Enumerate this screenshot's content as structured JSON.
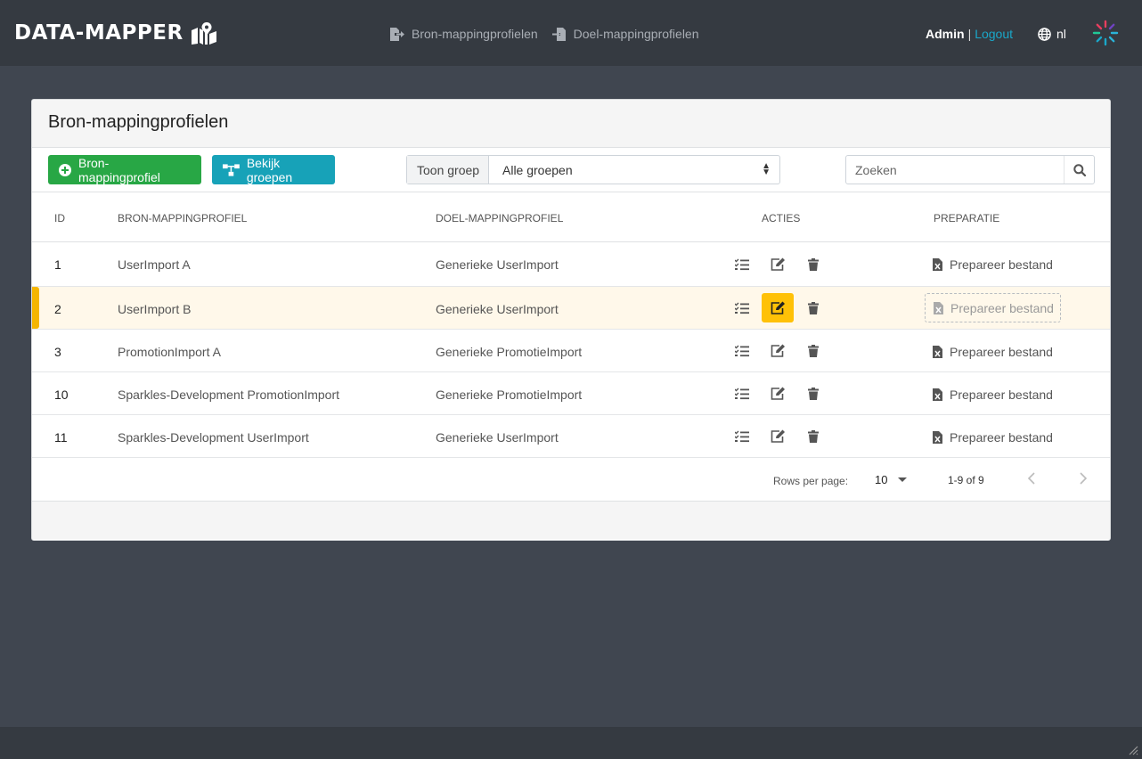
{
  "brand": {
    "name": "DATA-MAPPER"
  },
  "nav": {
    "source_profiles": "Bron-mappingprofielen",
    "target_profiles": "Doel-mappingprofielen",
    "user": "Admin",
    "separator": "|",
    "logout": "Logout",
    "language": "nl"
  },
  "card": {
    "title": "Bron-mappingprofielen",
    "add_button": "Bron-mappingprofiel",
    "groups_button": "Bekijk groepen",
    "group_filter_label": "Toon groep",
    "group_filter_value": "Alle groepen",
    "search_placeholder": "Zoeken"
  },
  "table": {
    "columns": {
      "id": "ID",
      "source": "BRON-MAPPINGPROFIEL",
      "target": "DOEL-MAPPINGPROFIEL",
      "actions": "ACTIES",
      "prep": "PREPARATIE"
    },
    "prep_label": "Prepareer bestand",
    "rows": [
      {
        "id": "1",
        "source": "UserImport A",
        "target": "Generieke UserImport"
      },
      {
        "id": "2",
        "source": "UserImport B",
        "target": "Generieke UserImport"
      },
      {
        "id": "3",
        "source": "PromotionImport A",
        "target": "Generieke PromotieImport"
      },
      {
        "id": "10",
        "source": "Sparkles-Development PromotionImport",
        "target": "Generieke PromotieImport"
      },
      {
        "id": "11",
        "source": "Sparkles-Development UserImport",
        "target": "Generieke UserImport"
      }
    ]
  },
  "pagination": {
    "rows_per_page_label": "Rows per page:",
    "rows_per_page": "10",
    "range": "1-9 of 9"
  },
  "colors": {
    "navbar": "#353a41",
    "background": "#404650",
    "accent_green": "#28a745",
    "accent_teal": "#17a2b8",
    "highlight": "#ffc107",
    "link": "#1aa7c9"
  },
  "icons": [
    "map-marked-icon",
    "export-file-icon",
    "import-file-icon",
    "globe-icon",
    "spinner-icon",
    "plus-circle-icon",
    "sitemap-icon",
    "search-icon",
    "tasks-icon",
    "edit-icon",
    "trash-icon",
    "file-excel-icon",
    "chevron-left-icon",
    "chevron-right-icon",
    "caret-down-icon"
  ]
}
